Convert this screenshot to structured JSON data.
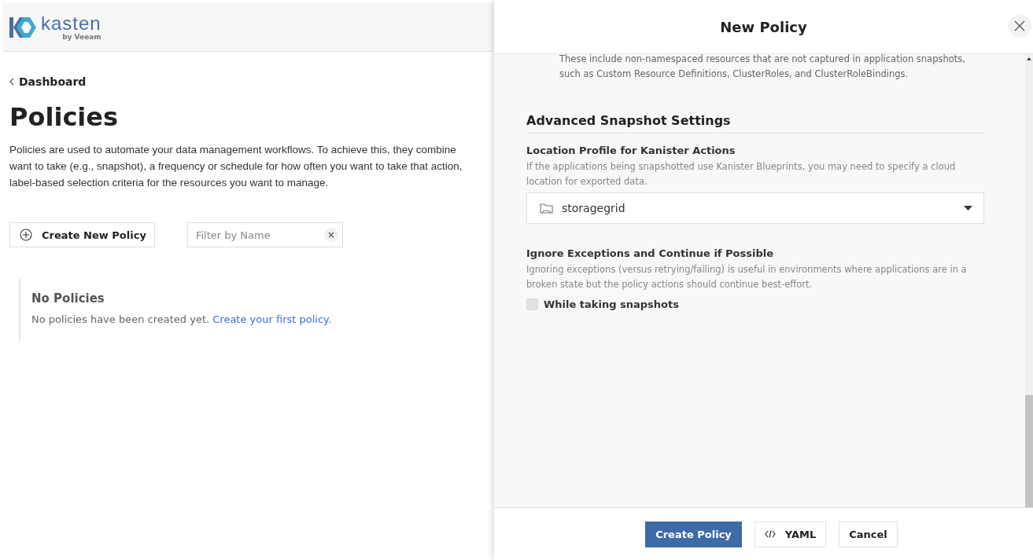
{
  "header": {
    "logo_text": "kasten",
    "logo_subtext": "by Veeam"
  },
  "breadcrumb": {
    "label": "Dashboard"
  },
  "page": {
    "title": "Policies",
    "description_lines": [
      "Policies are used to automate your data management workflows. To achieve this, they combine",
      "want to take (e.g., snapshot), a frequency or schedule for how often you want to take that action,",
      "label-based selection criteria for the resources you want to manage."
    ]
  },
  "toolbar": {
    "create_button": "Create New Policy",
    "filter": {
      "placeholder": "Filter by Name"
    }
  },
  "empty_state": {
    "title": "No Policies",
    "text": "No policies have been created yet.",
    "link": "Create your first policy."
  },
  "panel": {
    "title": "New Policy",
    "top_note": "These include non-namespaced resources that are not captured in application snapshots, such as Custom Resource Definitions, ClusterRoles, and ClusterRoleBindings.",
    "section_title": "Advanced Snapshot Settings",
    "fields": [
      {
        "kind": "select",
        "label": "Location Profile for Kanister Actions",
        "help": "If the applications being snapshotted use Kanister Blueprints, you may need to specify a cloud location for exported data.",
        "value": "storagegrid"
      },
      {
        "kind": "checkbox",
        "label": "Ignore Exceptions and Continue if Possible",
        "help": "Ignoring exceptions (versus retrying/failing) is useful in environments where applications are in a broken state but the policy actions should continue best-effort.",
        "option": "While taking snapshots",
        "checked": false
      }
    ],
    "buttons": [
      {
        "label": "Create Policy",
        "kind": "primary"
      },
      {
        "label": "YAML",
        "kind": "code"
      },
      {
        "label": "Cancel",
        "kind": "plain"
      }
    ]
  }
}
